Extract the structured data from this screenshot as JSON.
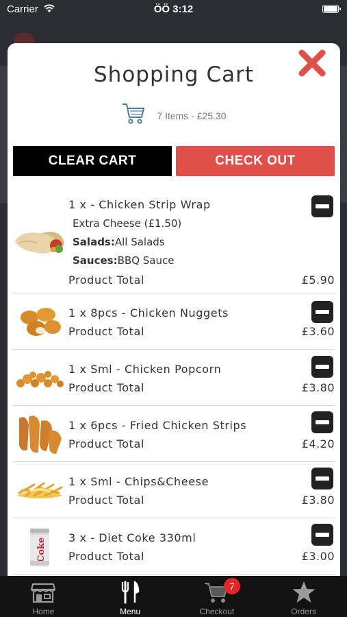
{
  "status_bar": {
    "carrier": "Carrier",
    "time": "ÖÖ 3:12"
  },
  "modal": {
    "title": "Shopping Cart",
    "summary": "7 Items - £25.30",
    "clear_label": "CLEAR CART",
    "checkout_label": "CHECK OUT",
    "accent_color": "#e14f4b"
  },
  "items": [
    {
      "name": "1 x - Chicken Strip Wrap",
      "extra": "Extra Cheese (£1.50)",
      "salads_label": "Salads:",
      "salads_value": "All Salads",
      "sauces_label": "Sauces:",
      "sauces_value": "BBQ Sauce",
      "total_label": "Product Total",
      "total": "£5.90",
      "icon": "wrap-image"
    },
    {
      "name": "1 x 8pcs - Chicken Nuggets",
      "total_label": "Product Total",
      "total": "£3.60",
      "icon": "nuggets-image"
    },
    {
      "name": "1 x Sml - Chicken Popcorn",
      "total_label": "Product Total",
      "total": "£3.80",
      "icon": "popcorn-image"
    },
    {
      "name": "1 x 6pcs - Fried Chicken Strips",
      "total_label": "Product Total",
      "total": "£4.20",
      "icon": "strips-image"
    },
    {
      "name": "1 x Sml - Chips&Cheese",
      "total_label": "Product Total",
      "total": "£3.80",
      "icon": "chips-image"
    },
    {
      "name": "3 x - Diet Coke 330ml",
      "total_label": "Product Total",
      "total": "£3.00",
      "icon": "coke-can-image"
    }
  ],
  "tabs": [
    {
      "label": "Home",
      "icon": "store-icon"
    },
    {
      "label": "Menu",
      "icon": "fork-knife-icon",
      "active": true
    },
    {
      "label": "Checkout",
      "icon": "cart-icon",
      "badge": "7"
    },
    {
      "label": "Orders",
      "icon": "star-icon"
    }
  ]
}
